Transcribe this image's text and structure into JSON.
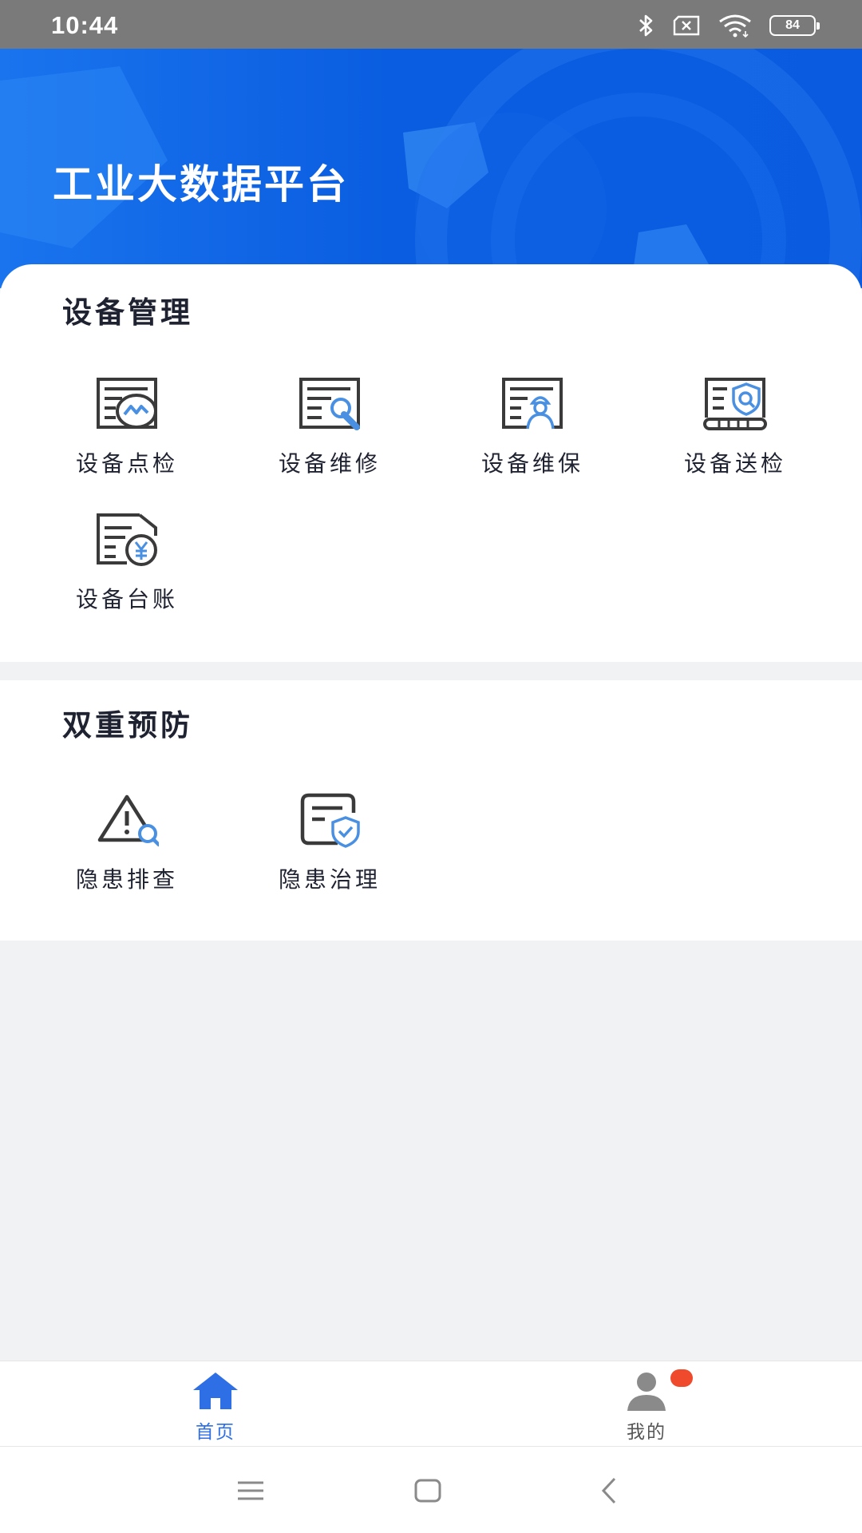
{
  "status_bar": {
    "time": "10:44",
    "battery": "84"
  },
  "header": {
    "title": "工业大数据平台"
  },
  "sections": [
    {
      "title": "设备管理",
      "items": [
        {
          "label": "设备点检",
          "icon": "equipment-inspection-icon"
        },
        {
          "label": "设备维修",
          "icon": "equipment-repair-icon"
        },
        {
          "label": "设备维保",
          "icon": "equipment-maintenance-icon"
        },
        {
          "label": "设备送检",
          "icon": "equipment-submit-inspection-icon"
        },
        {
          "label": "设备台账",
          "icon": "equipment-ledger-icon"
        }
      ]
    },
    {
      "title": "双重预防",
      "items": [
        {
          "label": "隐患排查",
          "icon": "hazard-investigation-icon"
        },
        {
          "label": "隐患治理",
          "icon": "hazard-governance-icon"
        }
      ]
    }
  ],
  "tab_bar": {
    "tabs": [
      {
        "label": "首页",
        "icon": "home-icon",
        "active": true
      },
      {
        "label": "我的",
        "icon": "user-icon",
        "active": false,
        "badge": true
      }
    ]
  },
  "colors": {
    "primary": "#2f6fe6",
    "icon_gray": "#3a3a3a",
    "icon_accent": "#4a90e2",
    "badge": "#f04a2c",
    "tab_inactive": "#555555"
  }
}
